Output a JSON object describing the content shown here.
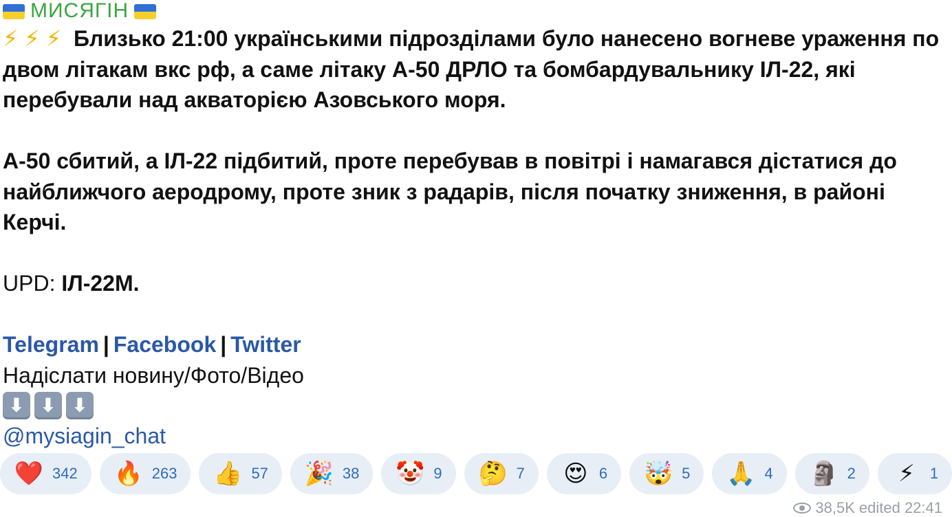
{
  "channel": {
    "name": "МИСЯГІН",
    "accent_color": "#3aa63f",
    "flag_icon": "ukraine-flag-icon"
  },
  "message": {
    "bolts": "⚡ ⚡ ⚡",
    "paragraph1": "Близько 21:00 українськими підрозділами було нанесено вогневе ураження по двом літакам вкс рф, а саме літаку А-50 ДРЛО та бомбардувальнику ІЛ-22, які перебували над акваторією Азовського моря.",
    "paragraph2": "А-50 сбитий, а ІЛ-22 підбитий, проте перебував в повітрі і намагався дістатися до найближчого аеродрому, проте зник з радарів, після початку зниження, в районі Керчі.",
    "upd_prefix": "UPD:",
    "upd_value": "ІЛ-22М.",
    "links": {
      "telegram": "Telegram",
      "facebook": "Facebook",
      "twitter": "Twitter",
      "separator": "|"
    },
    "send_news": "Надіслати новину/Фото/Відео",
    "arrow_glyph": "⬇",
    "chat_handle": "@mysiagin_chat"
  },
  "reactions": [
    {
      "icon": "heart-icon",
      "emoji": "❤️",
      "count": "342"
    },
    {
      "icon": "fire-icon",
      "emoji": "🔥",
      "count": "263"
    },
    {
      "icon": "thumbs-up-icon",
      "emoji": "👍",
      "count": "57"
    },
    {
      "icon": "party-popper-icon",
      "emoji": "🎉",
      "count": "38"
    },
    {
      "icon": "clown-face-icon",
      "emoji": "🤡",
      "count": "9"
    },
    {
      "icon": "thinking-face-icon",
      "emoji": "🤔",
      "count": "7"
    },
    {
      "icon": "heart-eyes-icon",
      "emoji": "😍",
      "count": "6"
    },
    {
      "icon": "exploding-head-icon",
      "emoji": "🤯",
      "count": "5"
    },
    {
      "icon": "folded-hands-icon",
      "emoji": "🙏",
      "count": "4"
    },
    {
      "icon": "moai-icon",
      "emoji": "🗿",
      "count": "2"
    },
    {
      "icon": "lightning-icon",
      "emoji": "⚡",
      "count": "1"
    }
  ],
  "meta": {
    "views": "38,5K",
    "edited_label": "edited 22:41",
    "link_color": "#2a58a8",
    "reaction_bg": "#e7eef6",
    "reaction_count_color": "#2f6cc0"
  }
}
